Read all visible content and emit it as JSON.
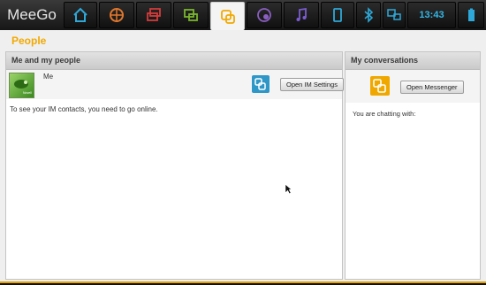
{
  "topbar": {
    "logo": "MeeGo",
    "clock": "13:43",
    "icons": [
      "home-icon",
      "web-browser-icon",
      "tasks-icon",
      "messaging-icon",
      "people-icon",
      "media-icon",
      "music-icon",
      "device-icon",
      "bluetooth-icon",
      "network-icon",
      "battery-icon"
    ]
  },
  "app": {
    "title": "People",
    "me_panel": {
      "header": "Me and my people",
      "me_label": "Me",
      "avatar_caption": "Novell",
      "open_im_button": "Open IM Settings",
      "offline_message": "To see your IM contacts, you need to go online."
    },
    "conv_panel": {
      "header": "My conversations",
      "open_messenger_button": "Open Messenger",
      "chatting_with": "You are chatting with:"
    }
  },
  "colors": {
    "accent": "#f2a900",
    "clock": "#35b7e6",
    "im_icon": "#2f97c7",
    "messenger_icon": "#f0a800"
  }
}
